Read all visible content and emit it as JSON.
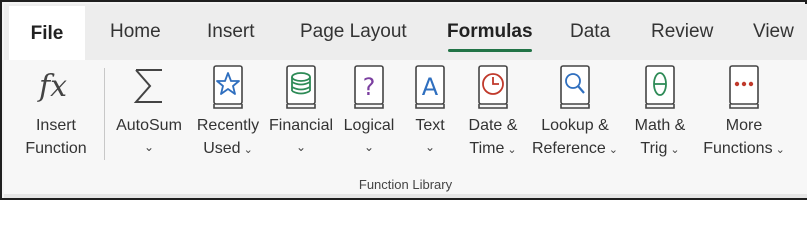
{
  "tabs": {
    "file": "File",
    "home": "Home",
    "insert": "Insert",
    "page_layout": "Page Layout",
    "formulas": "Formulas",
    "data": "Data",
    "review": "Review",
    "view": "View"
  },
  "ribbon": {
    "insert_function": {
      "line1": "Insert",
      "line2": "Function",
      "icon": "fx-icon"
    },
    "autosum": {
      "line1": "AutoSum",
      "icon": "sigma-icon"
    },
    "recently_used": {
      "line1": "Recently",
      "line2": "Used",
      "icon": "star-book-icon"
    },
    "financial": {
      "line1": "Financial",
      "icon": "coins-book-icon"
    },
    "logical": {
      "line1": "Logical",
      "icon": "question-book-icon"
    },
    "text": {
      "line1": "Text",
      "icon": "letter-a-book-icon"
    },
    "date_time": {
      "line1": "Date &",
      "line2": "Time",
      "icon": "clock-book-icon"
    },
    "lookup_reference": {
      "line1": "Lookup &",
      "line2": "Reference",
      "icon": "magnifier-book-icon"
    },
    "math_trig": {
      "line1": "Math &",
      "line2": "Trig",
      "icon": "theta-book-icon"
    },
    "more_functions": {
      "line1": "More",
      "line2": "Functions",
      "icon": "dots-book-icon"
    },
    "group_label": "Function Library"
  },
  "colors": {
    "accent_green": "#217346",
    "book_blue": "#2f6fbf",
    "book_green": "#2e8b57",
    "book_purple": "#7b3fa0",
    "book_red": "#c0392b"
  }
}
